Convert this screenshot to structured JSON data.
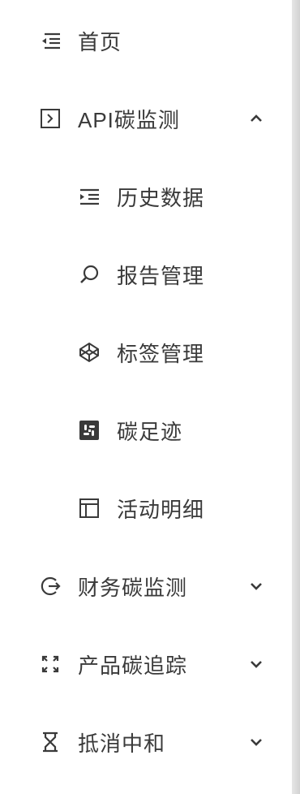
{
  "sidebar": {
    "items": [
      {
        "label": "首页",
        "icon": "indent-list-icon",
        "expandable": false
      },
      {
        "label": "API碳监测",
        "icon": "terminal-box-icon",
        "expandable": true,
        "expanded": true,
        "children": [
          {
            "label": "历史数据",
            "icon": "indent-list-icon"
          },
          {
            "label": "报告管理",
            "icon": "search-icon"
          },
          {
            "label": "标签管理",
            "icon": "codepen-icon"
          },
          {
            "label": "碳足迹",
            "icon": "slack-icon"
          },
          {
            "label": "活动明细",
            "icon": "layout-panel-icon"
          }
        ]
      },
      {
        "label": "财务碳监测",
        "icon": "logout-circle-icon",
        "expandable": true,
        "expanded": false
      },
      {
        "label": "产品碳追踪",
        "icon": "fullscreen-icon",
        "expandable": true,
        "expanded": false
      },
      {
        "label": "抵消中和",
        "icon": "hourglass-icon",
        "expandable": true,
        "expanded": false
      }
    ]
  },
  "colors": {
    "text": "#3a3a3a",
    "icon": "#3a3a3a",
    "background": "#ffffff",
    "edge": "#d9d9d9"
  }
}
